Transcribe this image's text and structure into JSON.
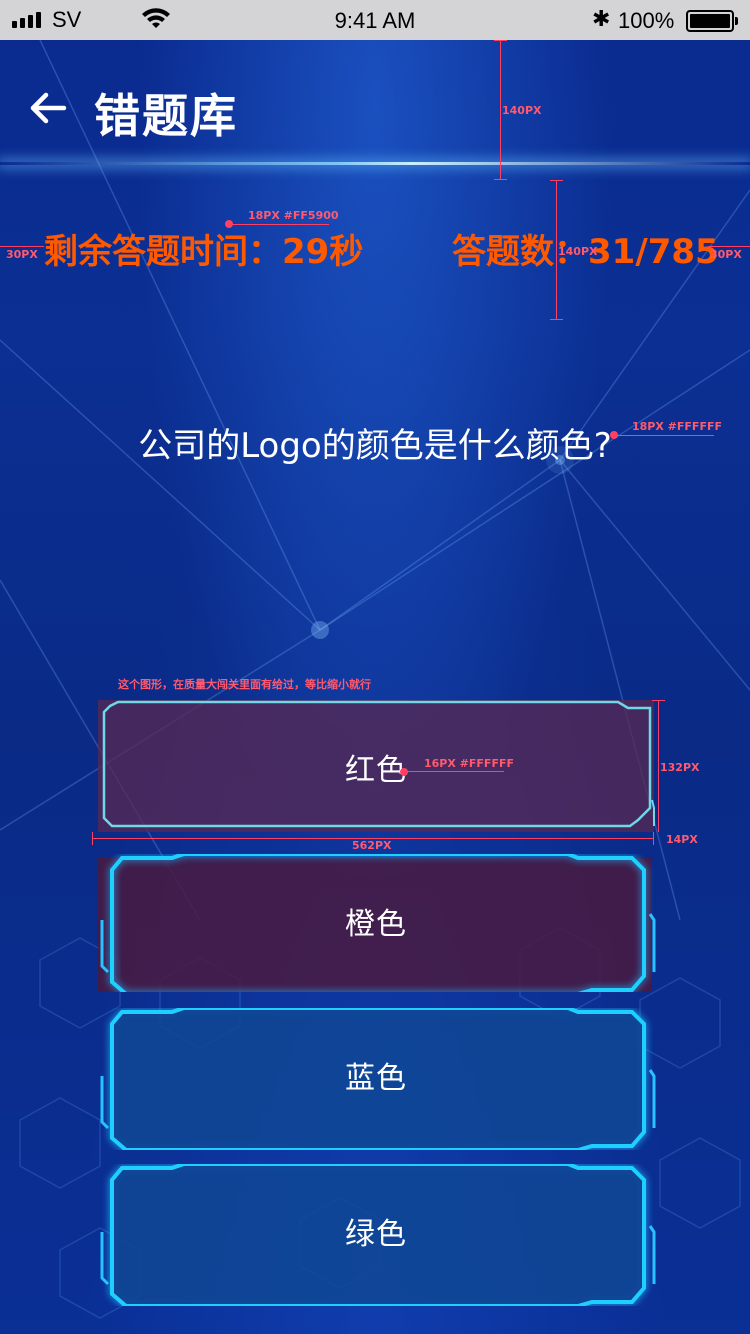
{
  "status_bar": {
    "carrier": "SV",
    "time": "9:41 AM",
    "battery": "100%"
  },
  "header": {
    "title": "错题库"
  },
  "stats": {
    "time_left": "剩余答题时间：29秒",
    "count": "答题数：31/785"
  },
  "question": {
    "text": "公司的Logo的颜色是什么颜色?"
  },
  "options": [
    {
      "label": "红色",
      "state": "selected"
    },
    {
      "label": "橙色",
      "state": "highlighted"
    },
    {
      "label": "蓝色",
      "state": "normal"
    },
    {
      "label": "绿色",
      "state": "normal"
    }
  ],
  "annotations": {
    "header_height": "140PX",
    "stats_height": "140PX",
    "margin_left": "30PX",
    "margin_right": "30PX",
    "stats_font": "18PX #FF5900",
    "question_font": "18PX #FFFFFF",
    "option_note": "这个图形，在质量大闯关里面有给过，等比缩小就行",
    "option_font": "16PX #FFFFFF",
    "option_height": "132PX",
    "option_gap": "14PX",
    "option_width": "562PX"
  },
  "colors": {
    "accent": "#FF5900",
    "frame_cyan": "#22d4ff",
    "selected_fill": "#5a2850",
    "annotation": "#ff4060"
  }
}
